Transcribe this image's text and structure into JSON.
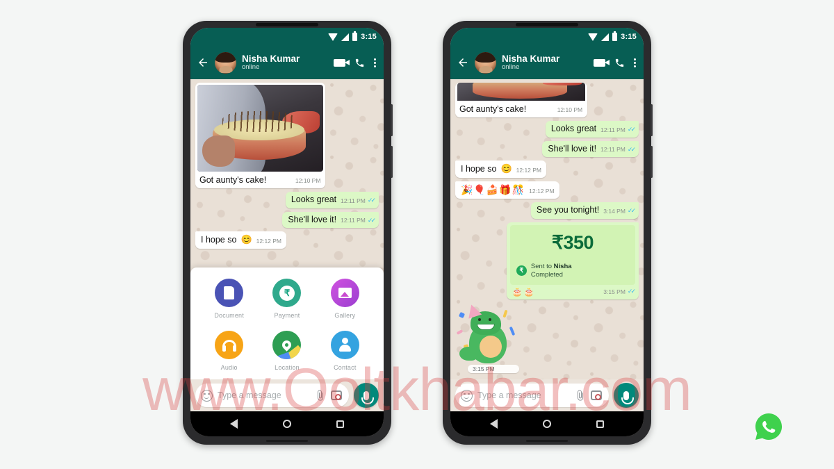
{
  "watermark": "www.Ooltkhabar.com",
  "status_bar": {
    "time": "3:15",
    "icons": [
      "wifi-icon",
      "signal-icon",
      "battery-icon"
    ]
  },
  "app_bar": {
    "back_icon": "back-arrow-icon",
    "avatar": "contact-avatar",
    "contact_name": "Nisha Kumar",
    "presence": "online",
    "video_call_icon": "video-call-icon",
    "voice_call_icon": "phone-call-icon",
    "overflow_icon": "more-options-icon"
  },
  "phone_left": {
    "messages": {
      "image_message": {
        "caption": "Got aunty's cake!",
        "time": "12:10 PM",
        "forward_icon": "forward-arrow-icon"
      },
      "looks_great": {
        "text": "Looks great",
        "time": "12:11 PM",
        "ticks": "✓✓"
      },
      "shell_love_it": {
        "text": "She'll love it!",
        "time": "12:11 PM",
        "ticks": "✓✓"
      },
      "i_hope_so": {
        "text": "I hope so",
        "emoji": "😊",
        "time": "12:12 PM"
      }
    },
    "attachment_sheet": {
      "items": [
        {
          "label": "Document",
          "icon": "document-icon",
          "color": "#4a53b5"
        },
        {
          "label": "Payment",
          "icon": "rupee-icon",
          "color": "#2fa98c"
        },
        {
          "label": "Gallery",
          "icon": "gallery-icon",
          "color": "#b93ec6"
        },
        {
          "label": "Audio",
          "icon": "headphones-icon",
          "color": "#f7a416"
        },
        {
          "label": "Location",
          "icon": "map-pin-icon",
          "color": "#2e9e53"
        },
        {
          "label": "Contact",
          "icon": "person-icon",
          "color": "#34a3e0"
        }
      ]
    }
  },
  "phone_right": {
    "messages": {
      "image_caption": {
        "text": "Got aunty's cake!",
        "time": "12:10 PM"
      },
      "looks_great": {
        "text": "Looks great",
        "time": "12:11 PM",
        "ticks": "✓✓"
      },
      "shell_love_it": {
        "text": "She'll love it!",
        "time": "12:11 PM",
        "ticks": "✓✓"
      },
      "i_hope_so": {
        "text": "I hope so",
        "emoji": "😊",
        "time": "12:12 PM"
      },
      "emoji_row": {
        "emojis": "🎉🎈🍰🎁🎊",
        "time": "12:12 PM"
      },
      "see_you_tonight": {
        "text": "See you tonight!",
        "time": "3:14 PM",
        "ticks": "✓✓"
      },
      "payment": {
        "amount": "₹350",
        "badge_glyph": "₹",
        "sent_to_prefix": "Sent to ",
        "sent_to_name": "Nisha",
        "status": "Completed",
        "cakes": "🎂🎂",
        "time": "3:15 PM",
        "ticks": "✓✓"
      },
      "sticker": {
        "name": "party-dinosaur-sticker",
        "time": "3:15 PM"
      }
    }
  },
  "input_bar": {
    "emoji_icon": "emoji-icon",
    "placeholder": "Type a message",
    "attach_icon": "paperclip-icon",
    "camera_icon": "camera-icon",
    "mic_icon": "microphone-icon"
  },
  "nav_bar": {
    "back": "nav-back-icon",
    "home": "nav-home-icon",
    "recents": "nav-recents-icon"
  },
  "brand_logo": "whatsapp-logo",
  "colors": {
    "header_green": "#075e54",
    "outgoing_bubble": "#dcf8c6",
    "incoming_bubble": "#ffffff",
    "chat_bg": "#e9e0d6",
    "mic_green": "#00897b",
    "tick_blue": "#34b7f1",
    "watermark_red": "#d83c3c"
  }
}
